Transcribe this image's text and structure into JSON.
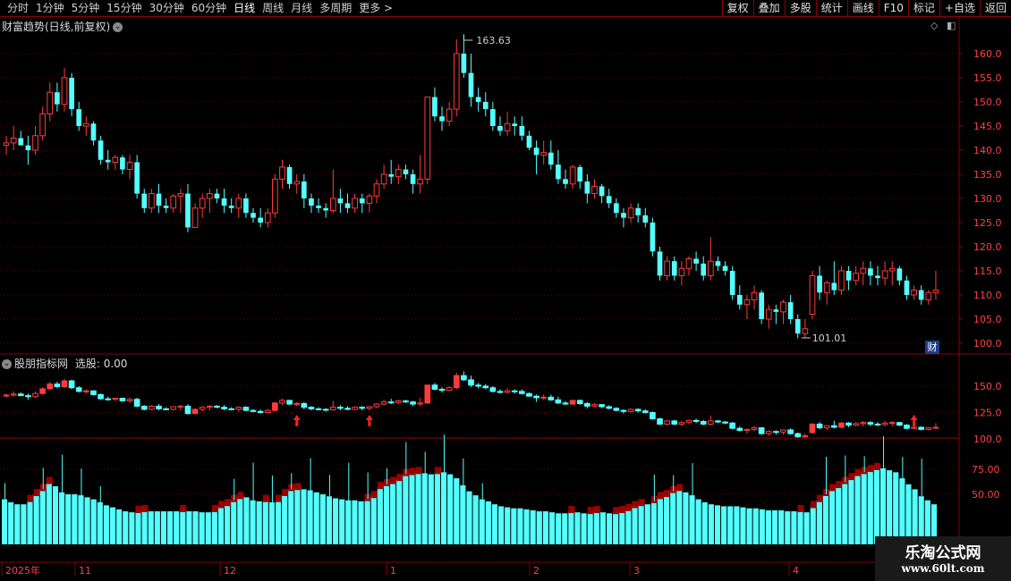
{
  "toolbar": {
    "periods": [
      "分时",
      "1分钟",
      "5分钟",
      "15分钟",
      "30分钟",
      "60分钟",
      "日线",
      "周线",
      "月线",
      "多周期",
      "更多 >"
    ],
    "active_period": "日线",
    "buttons": [
      "复权",
      "叠加",
      "多股",
      "统计",
      "画线",
      "F10",
      "标记",
      "+自选",
      "返回"
    ]
  },
  "main_panel": {
    "title": "财富趋势(日线,前复权)",
    "high_label": "163.63",
    "low_label": "101.01",
    "price_ticks": [
      "160.0",
      "155.0",
      "150.0",
      "145.0",
      "140.0",
      "135.0",
      "130.0",
      "125.0",
      "120.0",
      "115.0",
      "110.0",
      "105.0",
      "100.0"
    ],
    "fin_badge": "财"
  },
  "sub_panel": {
    "title": "股朋指标网",
    "select_label": "选股:",
    "select_value": "0.00",
    "upper_ticks": [
      "150.0",
      "125.0",
      "100.0"
    ],
    "lower_ticks": [
      "75.00",
      "50.00"
    ]
  },
  "date_axis": {
    "labels": [
      "2025年",
      "11",
      "12",
      "1",
      "2",
      "3",
      "4"
    ]
  },
  "watermark": {
    "line1": "乐淘公式网",
    "line2": "www.60lt.com"
  },
  "colors": {
    "up": "#ff3c3c",
    "down": "#54ffff",
    "panel_border": "#8a0000",
    "hist_fill": "#54ffff",
    "hist_band": "#9a0000",
    "signal_arrow": "#ff1e1e"
  },
  "candles": [
    [
      141,
      143,
      139,
      141.5
    ],
    [
      141.5,
      145,
      140,
      142.5
    ],
    [
      142.5,
      144,
      141,
      141
    ],
    [
      141,
      143,
      137,
      140
    ],
    [
      140,
      145,
      139,
      143
    ],
    [
      143,
      149,
      142,
      147.5
    ],
    [
      147.5,
      154,
      146,
      152
    ],
    [
      152,
      154,
      148,
      149.5
    ],
    [
      149.5,
      157,
      148,
      155
    ],
    [
      155,
      156,
      147,
      148.5
    ],
    [
      148.5,
      150,
      144,
      145
    ],
    [
      145,
      147,
      143,
      145.5
    ],
    [
      145.5,
      146,
      141,
      142
    ],
    [
      142,
      143,
      137,
      138
    ],
    [
      138,
      140,
      136,
      137.5
    ],
    [
      137.5,
      139,
      136,
      138.5
    ],
    [
      138.5,
      139,
      135,
      136
    ],
    [
      136,
      139,
      134,
      137.5
    ],
    [
      137.5,
      139,
      130,
      131
    ],
    [
      131,
      132,
      127,
      128
    ],
    [
      128,
      132,
      127,
      131
    ],
    [
      131,
      133,
      127,
      128.5
    ],
    [
      128.5,
      130,
      127,
      128
    ],
    [
      128,
      131,
      127,
      130.5
    ],
    [
      130.5,
      132,
      127,
      131
    ],
    [
      131,
      133,
      123,
      124
    ],
    [
      124,
      129,
      124,
      128
    ],
    [
      128,
      131,
      126,
      130
    ],
    [
      130,
      132,
      127,
      131
    ],
    [
      131,
      132,
      129,
      130
    ],
    [
      130,
      132,
      127,
      128.5
    ],
    [
      128.5,
      130,
      127,
      128
    ],
    [
      128,
      131,
      126,
      130
    ],
    [
      130,
      131,
      126,
      127
    ],
    [
      127,
      128,
      125,
      126
    ],
    [
      126,
      128,
      124,
      125
    ],
    [
      125,
      128,
      124,
      127
    ],
    [
      127,
      135,
      126,
      134
    ],
    [
      134,
      138,
      132,
      136.5
    ],
    [
      136.5,
      137,
      132,
      133
    ],
    [
      133,
      135,
      131,
      133.5
    ],
    [
      133.5,
      135,
      128,
      130
    ],
    [
      130,
      131,
      127,
      128.5
    ],
    [
      128.5,
      130,
      127,
      128
    ],
    [
      128,
      129,
      126,
      127.5
    ],
    [
      127.5,
      136,
      127,
      130
    ],
    [
      130,
      132,
      127,
      129
    ],
    [
      129,
      131,
      127,
      128
    ],
    [
      128,
      131,
      127,
      130
    ],
    [
      130,
      131,
      127,
      129
    ],
    [
      129,
      131,
      127,
      130.5
    ],
    [
      130.5,
      134,
      129,
      133
    ],
    [
      133,
      137,
      132,
      135
    ],
    [
      135,
      138,
      133,
      134.5
    ],
    [
      134.5,
      137,
      133,
      136
    ],
    [
      136,
      137,
      134,
      135
    ],
    [
      135,
      136,
      131,
      133
    ],
    [
      133,
      139,
      131,
      134
    ],
    [
      134,
      151,
      133,
      151
    ],
    [
      151,
      153,
      146,
      147
    ],
    [
      147,
      149,
      144,
      146
    ],
    [
      146,
      150,
      145,
      148.5
    ],
    [
      148.5,
      163,
      147,
      160
    ],
    [
      160,
      164,
      155,
      156
    ],
    [
      156,
      160,
      149,
      151
    ],
    [
      151,
      153,
      148,
      150
    ],
    [
      150,
      152,
      147,
      148.5
    ],
    [
      148.5,
      150,
      144,
      145
    ],
    [
      145,
      147,
      143,
      144
    ],
    [
      144,
      148,
      143,
      145.5
    ],
    [
      145.5,
      147,
      143,
      145
    ],
    [
      145,
      147,
      142,
      143
    ],
    [
      143,
      144,
      140,
      140.5
    ],
    [
      140.5,
      142,
      135,
      139
    ],
    [
      139,
      142,
      137,
      139.5
    ],
    [
      139.5,
      142,
      136,
      137
    ],
    [
      137,
      140,
      133,
      134
    ],
    [
      134,
      136,
      132,
      133
    ],
    [
      133,
      137,
      132,
      136.5
    ],
    [
      136.5,
      137,
      132,
      133.5
    ],
    [
      133.5,
      135,
      129,
      131
    ],
    [
      131,
      134,
      130,
      132.5
    ],
    [
      132.5,
      133,
      129,
      130.5
    ],
    [
      130.5,
      132,
      128,
      129
    ],
    [
      129,
      130,
      126,
      127
    ],
    [
      127,
      128,
      124,
      126
    ],
    [
      126,
      129,
      125,
      128
    ],
    [
      128,
      129,
      125,
      126.5
    ],
    [
      126.5,
      128,
      124,
      125
    ],
    [
      125,
      126,
      118,
      119
    ],
    [
      119,
      120,
      113,
      114
    ],
    [
      114,
      118,
      113,
      117
    ],
    [
      117,
      118,
      113,
      114
    ],
    [
      114,
      117,
      112,
      115.5
    ],
    [
      115.5,
      118,
      114,
      117.5
    ],
    [
      117.5,
      119,
      115,
      116.5
    ],
    [
      116.5,
      118,
      113,
      114
    ],
    [
      114,
      122,
      113,
      117
    ],
    [
      117,
      118,
      115,
      116
    ],
    [
      116,
      117,
      114,
      115
    ],
    [
      115,
      116,
      109,
      110
    ],
    [
      110,
      112,
      107,
      108
    ],
    [
      108,
      110,
      105,
      109
    ],
    [
      109,
      112,
      107,
      110.5
    ],
    [
      110.5,
      111,
      104,
      105
    ],
    [
      105,
      108,
      103,
      107
    ],
    [
      107,
      108,
      104,
      106.5
    ],
    [
      106.5,
      109,
      104,
      108.5
    ],
    [
      108.5,
      110,
      104,
      105
    ],
    [
      105,
      106,
      101,
      102
    ],
    [
      102,
      105,
      101,
      103
    ],
    [
      106,
      115,
      105,
      114
    ],
    [
      114,
      116,
      109,
      110.5
    ],
    [
      110.5,
      113,
      108,
      112.5
    ],
    [
      112.5,
      117,
      110,
      111
    ],
    [
      111,
      116,
      110,
      115
    ],
    [
      115,
      116,
      111,
      113
    ],
    [
      113,
      116,
      112,
      114.5
    ],
    [
      114.5,
      117,
      112,
      115.5
    ],
    [
      115.5,
      117,
      112,
      114
    ],
    [
      114,
      116,
      112,
      113.5
    ],
    [
      113.5,
      117,
      112,
      115
    ],
    [
      115,
      117,
      112,
      115.5
    ],
    [
      115.5,
      116,
      112,
      113
    ],
    [
      113,
      114,
      109,
      110
    ],
    [
      110,
      112,
      109,
      111
    ],
    [
      111,
      112,
      108,
      109
    ],
    [
      109,
      111,
      108,
      110.5
    ],
    [
      110.5,
      115,
      109,
      111
    ]
  ],
  "hist_values": [
    45,
    42,
    40,
    40,
    44,
    50,
    55,
    62,
    58,
    52,
    50,
    50,
    49,
    47,
    45,
    42,
    39,
    37,
    35,
    33,
    32,
    33,
    34,
    33,
    33,
    33,
    33,
    33,
    34,
    33,
    33,
    32,
    32,
    34,
    38,
    40,
    44,
    47,
    47,
    44,
    43,
    44,
    42,
    44,
    50,
    55,
    56,
    55,
    54,
    52,
    50,
    48,
    46,
    45,
    44,
    44,
    43,
    45,
    48,
    57,
    60,
    62,
    65,
    70,
    71,
    72,
    71,
    70,
    72,
    72,
    70,
    66,
    59,
    53,
    49,
    45,
    43,
    40,
    38,
    37,
    36,
    36,
    35,
    34,
    33,
    33,
    32,
    31,
    31,
    33,
    32,
    31,
    32,
    33,
    32,
    31,
    32,
    33,
    35,
    38,
    40,
    40,
    43,
    47,
    49,
    53,
    55,
    52,
    49,
    45,
    42,
    40,
    39,
    38,
    38,
    38,
    37,
    36,
    36,
    35,
    34,
    34,
    34,
    33,
    33,
    34,
    32,
    38,
    44,
    50,
    55,
    58,
    62,
    66,
    70,
    72,
    74,
    76,
    76,
    74,
    72,
    66,
    60,
    55,
    48,
    44,
    40
  ]
}
